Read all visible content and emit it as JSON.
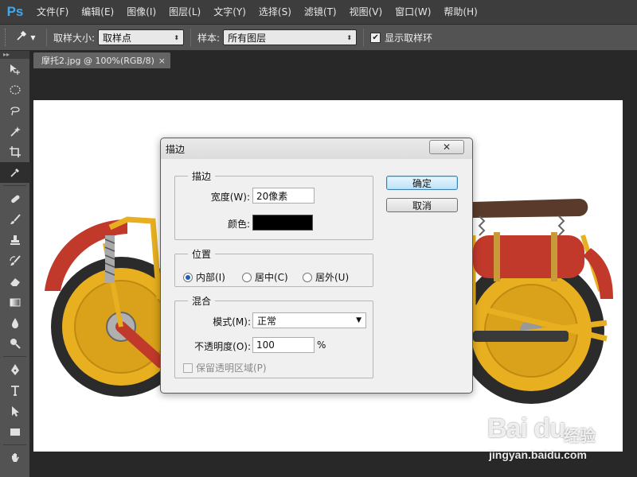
{
  "app": {
    "logo": "Ps"
  },
  "menu": [
    "文件(F)",
    "编辑(E)",
    "图像(I)",
    "图层(L)",
    "文字(Y)",
    "选择(S)",
    "滤镜(T)",
    "视图(V)",
    "窗口(W)",
    "帮助(H)"
  ],
  "options": {
    "tool_icon": "eyedropper-icon",
    "sample_size_label": "取样大小:",
    "sample_size_value": "取样点",
    "sample_label": "样本:",
    "sample_value": "所有图层",
    "show_ring_label": "显示取样环",
    "show_ring_checked": true
  },
  "tools": [
    "move-tool-icon",
    "marquee-tool-icon",
    "lasso-tool-icon",
    "magic-wand-tool-icon",
    "crop-tool-icon",
    "eyedropper-tool-icon",
    "healing-brush-tool-icon",
    "brush-tool-icon",
    "clone-stamp-tool-icon",
    "history-brush-tool-icon",
    "eraser-tool-icon",
    "gradient-tool-icon",
    "blur-tool-icon",
    "dodge-tool-icon",
    "pen-tool-icon",
    "type-tool-icon",
    "path-selection-tool-icon",
    "rectangle-tool-icon",
    "hand-tool-icon"
  ],
  "document": {
    "tab_label": "摩托2.jpg @ 100%(RGB/8)",
    "close": "×"
  },
  "dialog": {
    "title": "描边",
    "close": "✕",
    "stroke_group": {
      "title": "描边",
      "width_label": "宽度(W):",
      "width_value": "20像素",
      "color_label": "颜色:",
      "color_value": "#000000"
    },
    "position_group": {
      "title": "位置",
      "options": [
        "内部(I)",
        "居中(C)",
        "居外(U)"
      ],
      "selected": 0
    },
    "blend_group": {
      "title": "混合",
      "mode_label": "模式(M):",
      "mode_value": "正常",
      "opacity_label": "不透明度(O):",
      "opacity_value": "100",
      "opacity_unit": "%",
      "preserve_label": "保留透明区域(P)",
      "preserve_checked": false,
      "preserve_enabled": false
    },
    "ok_label": "确定",
    "cancel_label": "取消"
  },
  "watermark": {
    "brand": "Bai du",
    "sub": "经验",
    "url": "jingyan.baidu.com"
  },
  "colors": {
    "accent": "#3ea8f0",
    "motor_yellow": "#e8b020",
    "motor_red": "#c0392b",
    "stroke_color": "#000000"
  }
}
